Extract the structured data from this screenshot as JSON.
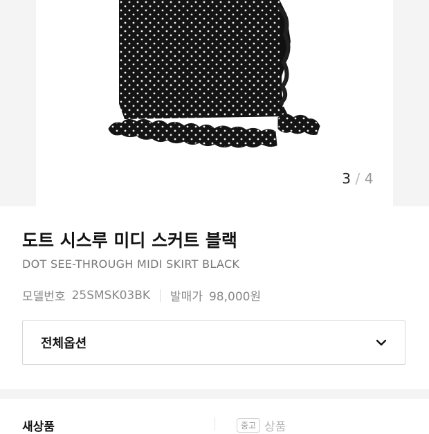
{
  "gallery": {
    "current": "3",
    "separator": "/",
    "total": "4"
  },
  "product": {
    "name_kr": "도트 시스루 미디 스커트 블랙",
    "name_en": "DOT SEE-THROUGH MIDI SKIRT BLACK",
    "model_label": "모델번호",
    "model_no": "25SMSK03BK",
    "price_label": "발매가",
    "price": "98,000원"
  },
  "options": {
    "label": "전체옵션",
    "icon": "chevron-down-icon"
  },
  "tabs": {
    "new_label": "새상품",
    "used_badge": "중고",
    "used_label": "상품"
  },
  "colors": {
    "skirt": "#141414",
    "dot": "#f2f2f2",
    "gallery_bg": "#f4f4f4"
  }
}
